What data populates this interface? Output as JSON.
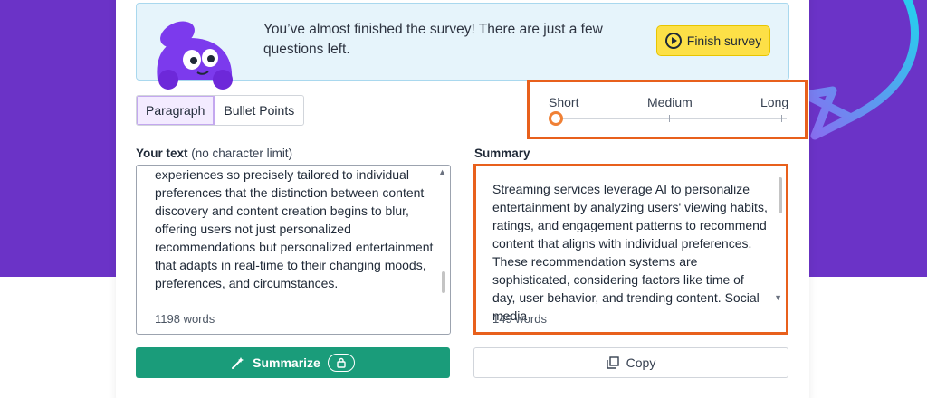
{
  "banner": {
    "message": "You’ve almost finished the survey! There are just a few questions left.",
    "button_label": "Finish survey",
    "button_icon": "play-circle-icon"
  },
  "mode_tabs": [
    {
      "label": "Paragraph",
      "active": true
    },
    {
      "label": "Bullet Points",
      "active": false
    }
  ],
  "length_slider": {
    "labels": [
      "Short",
      "Medium",
      "Long"
    ],
    "selected": "Short",
    "value": 0
  },
  "input": {
    "label": "Your text",
    "sublabel": "(no character limit)",
    "text": "experiences so precisely tailored to individual preferences that the distinction between content discovery and content creation begins to blur, offering users not just personalized recommendations but personalized entertainment that adapts in real-time to their changing moods, preferences, and circumstances.",
    "word_count": "1198 words"
  },
  "summary": {
    "label": "Summary",
    "text": "Streaming services leverage AI to personalize entertainment by analyzing users' viewing habits, ratings, and engagement patterns to recommend content that aligns with individual preferences. These recommendation systems are sophisticated, considering factors like time of day, user behavior, and trending content. Social media",
    "word_count": "149 words"
  },
  "actions": {
    "summarize_label": "Summarize",
    "summarize_icon": "magic-wand-icon",
    "lock_icon": "lock-icon",
    "copy_label": "Copy",
    "copy_icon": "copy-icon"
  },
  "colors": {
    "background_purple": "#6b33c7",
    "accent_green": "#1a9c7a",
    "highlight_orange": "#e8601c",
    "banner_yellow": "#fde047"
  }
}
